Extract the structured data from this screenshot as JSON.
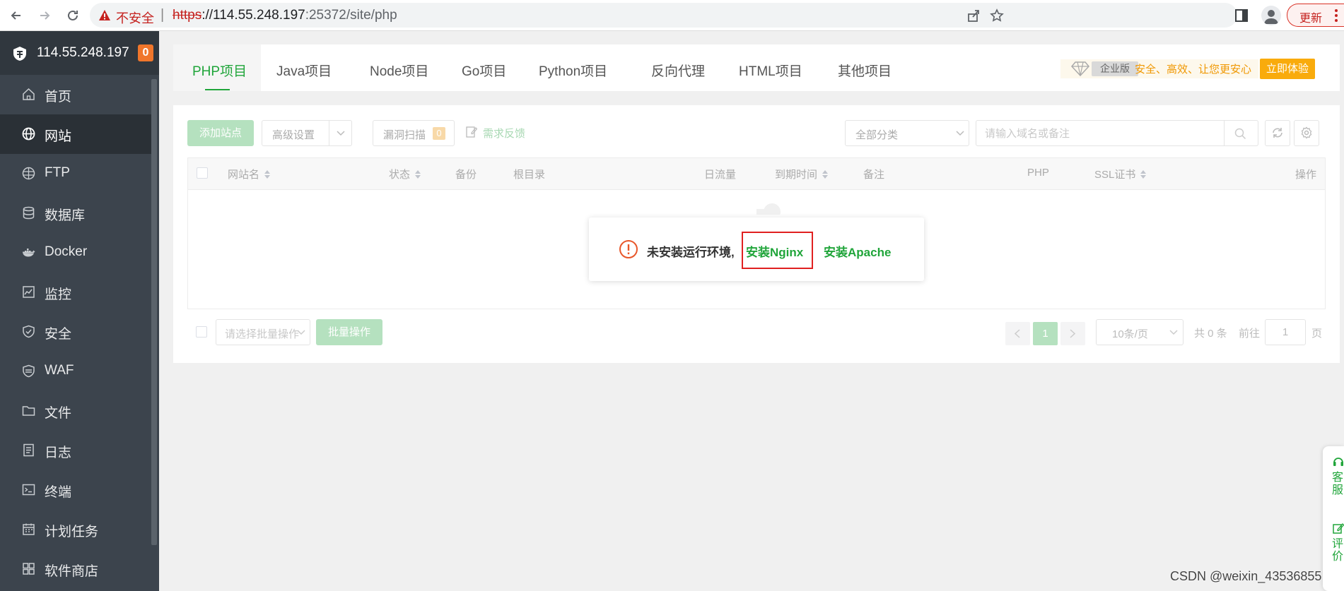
{
  "browser": {
    "insecure_label": "不安全",
    "separator": "|",
    "url_protocol": "https",
    "url_host": "://114.55.248.197",
    "url_path": ":25372/site/php",
    "update_label": "更新"
  },
  "sidebar": {
    "server_ip": "114.55.248.197",
    "badge_count": "0",
    "items": [
      {
        "label": "首页",
        "icon": "home-icon"
      },
      {
        "label": "网站",
        "icon": "globe-icon",
        "active": true
      },
      {
        "label": "FTP",
        "icon": "ftp-icon"
      },
      {
        "label": "数据库",
        "icon": "database-icon"
      },
      {
        "label": "Docker",
        "icon": "docker-icon"
      },
      {
        "label": "监控",
        "icon": "monitor-icon"
      },
      {
        "label": "安全",
        "icon": "shield-icon"
      },
      {
        "label": "WAF",
        "icon": "waf-icon"
      },
      {
        "label": "文件",
        "icon": "folder-icon"
      },
      {
        "label": "日志",
        "icon": "log-icon"
      },
      {
        "label": "终端",
        "icon": "terminal-icon"
      },
      {
        "label": "计划任务",
        "icon": "calendar-icon"
      },
      {
        "label": "软件商店",
        "icon": "grid-icon"
      }
    ]
  },
  "tabs": [
    {
      "label": "PHP项目",
      "active": true
    },
    {
      "label": "Java项目"
    },
    {
      "label": "Node项目"
    },
    {
      "label": "Go项目"
    },
    {
      "label": "Python项目"
    },
    {
      "label": "反向代理"
    },
    {
      "label": "HTML项目"
    },
    {
      "label": "其他项目"
    }
  ],
  "promo": {
    "tag": "企业版",
    "text": "安全、高效、让您更安心",
    "button": "立即体验"
  },
  "toolbar": {
    "add_site": "添加站点",
    "advanced_settings": "高级设置",
    "vuln_scan": "漏洞扫描",
    "vuln_count": "0",
    "feedback": "需求反馈",
    "category": "全部分类",
    "search_placeholder": "请输入域名或备注"
  },
  "table": {
    "headers": {
      "site_name": "网站名",
      "status": "状态",
      "backup": "备份",
      "root_dir": "根目录",
      "daily_traffic": "日流量",
      "expire": "到期时间",
      "note": "备注",
      "php": "PHP",
      "ssl": "SSL证书",
      "actions": "操作"
    }
  },
  "pagination": {
    "batch_placeholder": "请选择批量操作",
    "batch_button": "批量操作",
    "current_page": "1",
    "page_size": "10条/页",
    "total": "共 0 条",
    "goto_label": "前往",
    "goto_value": "1",
    "page_suffix": "页"
  },
  "dialog": {
    "message": "未安装运行环境,",
    "install_nginx": "安装Nginx",
    "install_apache": "安装Apache"
  },
  "float_panel": {
    "service": "客服",
    "review": "评价"
  },
  "watermark": "CSDN @weixin_43536855",
  "colors": {
    "accent_green": "#20a53a",
    "sidebar_bg": "#3c444d",
    "badge_orange": "#f0762b",
    "promo_orange": "#f9ab0c",
    "warning_red": "#e8572a",
    "highlight_red": "#e02020"
  }
}
